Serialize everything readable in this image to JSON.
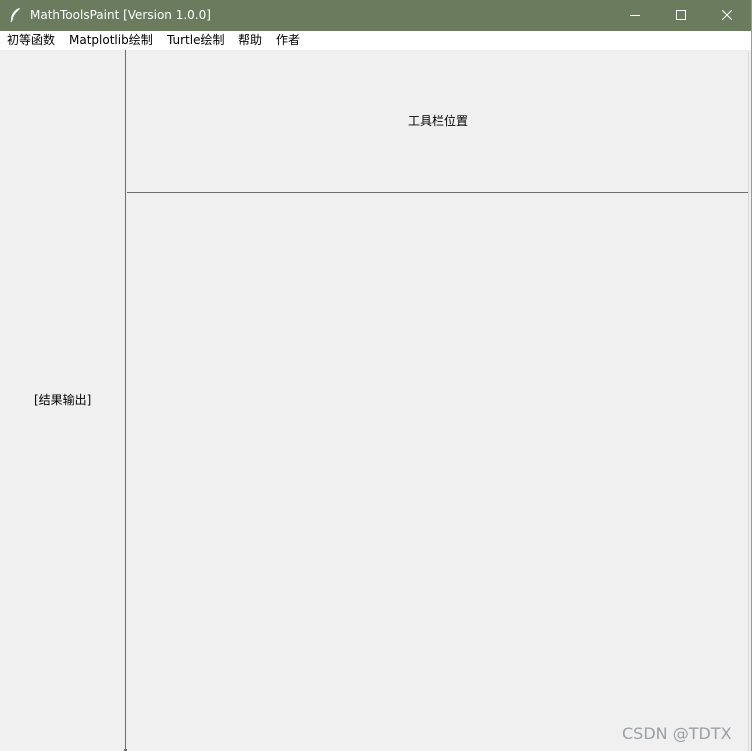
{
  "window": {
    "title": "MathToolsPaint [Version 1.0.0]",
    "titlebar_color": "#6a7b5e",
    "icon": "feather-icon",
    "controls": {
      "minimize_icon": "minimize-icon",
      "maximize_icon": "maximize-icon",
      "close_icon": "close-icon"
    }
  },
  "menubar": {
    "items": [
      {
        "label": "初等函数"
      },
      {
        "label": "Matplotlib绘制"
      },
      {
        "label": "Turtle绘制"
      },
      {
        "label": "帮助"
      },
      {
        "label": "作者"
      }
    ]
  },
  "left_panel": {
    "label": "[结果输出]"
  },
  "toolbar_area": {
    "label": "工具栏位置"
  },
  "watermark": {
    "text": "CSDN @TDTX"
  }
}
